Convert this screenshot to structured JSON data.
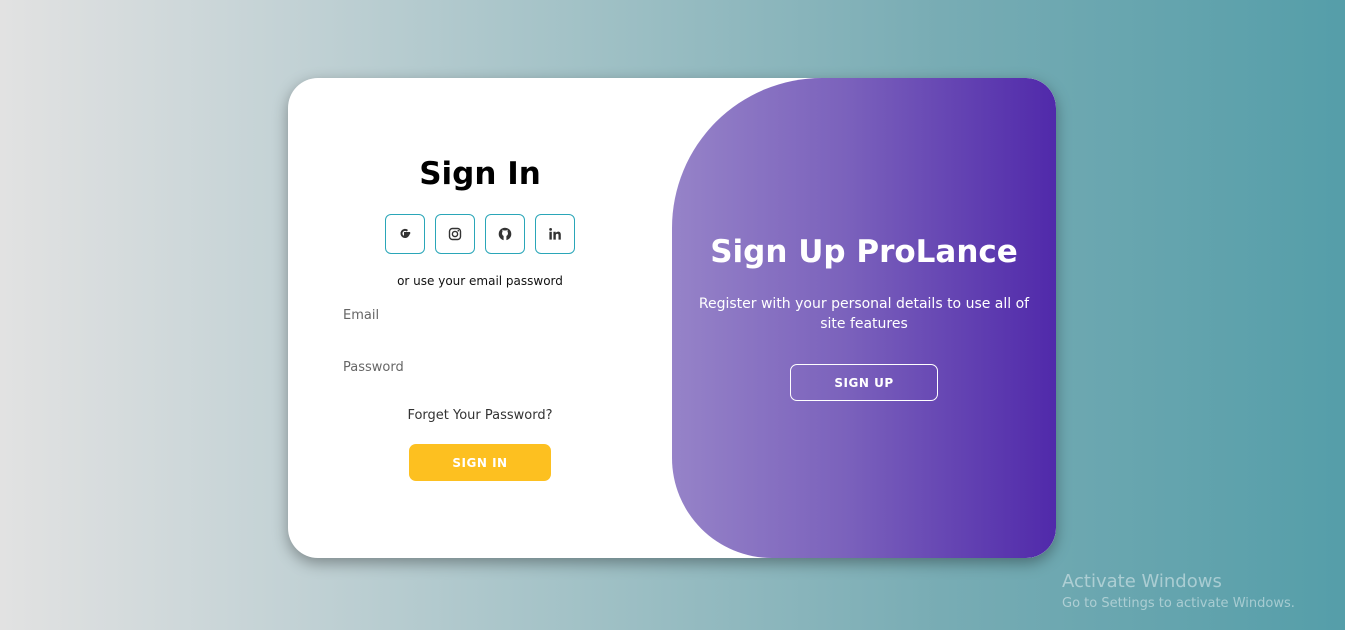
{
  "signin": {
    "title": "Sign In",
    "social_icons": [
      "google-icon",
      "instagram-icon",
      "github-icon",
      "linkedin-icon"
    ],
    "divider_text": "or use your email password",
    "email_placeholder": "Email",
    "password_placeholder": "Password",
    "forgot_text": "Forget Your Password?",
    "button_label": "SIGN IN"
  },
  "signup": {
    "title": "Sign Up ProLance",
    "description": "Register with your personal details to use all of site features",
    "button_label": "SIGN UP"
  },
  "watermark": {
    "title": "Activate Windows",
    "subtitle": "Go to Settings to activate Windows."
  },
  "colors": {
    "accent_yellow": "#fdc020",
    "social_border": "#2aa6b8",
    "overlay_start": "#9683c8",
    "overlay_end": "#5029aa"
  }
}
